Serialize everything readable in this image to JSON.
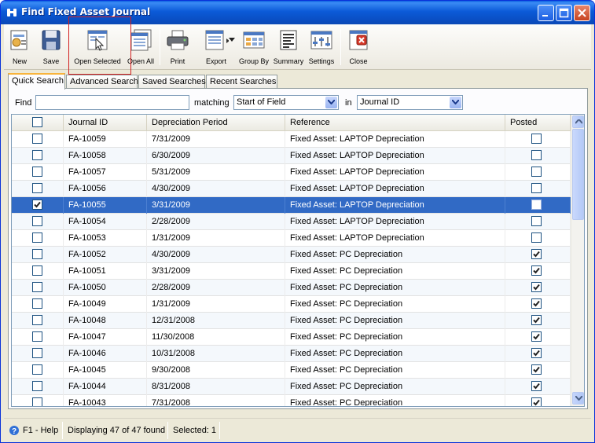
{
  "window": {
    "title": "Find Fixed Asset Journal"
  },
  "toolbar": {
    "buttons": [
      {
        "label": "New",
        "icon": "new-document-icon"
      },
      {
        "label": "Save",
        "icon": "floppy-disk-icon"
      },
      {
        "label": "Open Selected",
        "icon": "open-selected-icon"
      },
      {
        "label": "Open All",
        "icon": "open-all-icon"
      },
      {
        "label": "Print",
        "icon": "printer-icon"
      },
      {
        "label": "Export",
        "icon": "export-icon"
      },
      {
        "label": "Group By",
        "icon": "group-by-icon"
      },
      {
        "label": "Summary",
        "icon": "summary-icon"
      },
      {
        "label": "Settings",
        "icon": "settings-icon"
      },
      {
        "label": "Close",
        "icon": "close-document-icon"
      }
    ]
  },
  "tabs": [
    "Quick Search",
    "Advanced Search",
    "Saved Searches",
    "Recent Searches"
  ],
  "search": {
    "find_label": "Find",
    "find_value": "",
    "matching_label": "matching",
    "matching_value": "Start of Field",
    "in_label": "in",
    "in_value": "Journal ID"
  },
  "grid": {
    "columns": [
      "",
      "Journal ID",
      "Depreciation Period",
      "Reference",
      "Posted"
    ],
    "rows": [
      {
        "selected": false,
        "id": "FA-10059",
        "period": "7/31/2009",
        "reference": "Fixed Asset: LAPTOP Depreciation",
        "posted": false
      },
      {
        "selected": false,
        "id": "FA-10058",
        "period": "6/30/2009",
        "reference": "Fixed Asset: LAPTOP Depreciation",
        "posted": false
      },
      {
        "selected": false,
        "id": "FA-10057",
        "period": "5/31/2009",
        "reference": "Fixed Asset: LAPTOP Depreciation",
        "posted": false
      },
      {
        "selected": false,
        "id": "FA-10056",
        "period": "4/30/2009",
        "reference": "Fixed Asset: LAPTOP Depreciation",
        "posted": false
      },
      {
        "selected": true,
        "id": "FA-10055",
        "period": "3/31/2009",
        "reference": "Fixed Asset: LAPTOP Depreciation",
        "posted": false
      },
      {
        "selected": false,
        "id": "FA-10054",
        "period": "2/28/2009",
        "reference": "Fixed Asset: LAPTOP Depreciation",
        "posted": false
      },
      {
        "selected": false,
        "id": "FA-10053",
        "period": "1/31/2009",
        "reference": "Fixed Asset: LAPTOP Depreciation",
        "posted": false
      },
      {
        "selected": false,
        "id": "FA-10052",
        "period": "4/30/2009",
        "reference": "Fixed Asset: PC Depreciation",
        "posted": true
      },
      {
        "selected": false,
        "id": "FA-10051",
        "period": "3/31/2009",
        "reference": "Fixed Asset: PC Depreciation",
        "posted": true
      },
      {
        "selected": false,
        "id": "FA-10050",
        "period": "2/28/2009",
        "reference": "Fixed Asset: PC Depreciation",
        "posted": true
      },
      {
        "selected": false,
        "id": "FA-10049",
        "period": "1/31/2009",
        "reference": "Fixed Asset: PC Depreciation",
        "posted": true
      },
      {
        "selected": false,
        "id": "FA-10048",
        "period": "12/31/2008",
        "reference": "Fixed Asset: PC Depreciation",
        "posted": true
      },
      {
        "selected": false,
        "id": "FA-10047",
        "period": "11/30/2008",
        "reference": "Fixed Asset: PC Depreciation",
        "posted": true
      },
      {
        "selected": false,
        "id": "FA-10046",
        "period": "10/31/2008",
        "reference": "Fixed Asset: PC Depreciation",
        "posted": true
      },
      {
        "selected": false,
        "id": "FA-10045",
        "period": "9/30/2008",
        "reference": "Fixed Asset: PC Depreciation",
        "posted": true
      },
      {
        "selected": false,
        "id": "FA-10044",
        "period": "8/31/2008",
        "reference": "Fixed Asset: PC Depreciation",
        "posted": true
      },
      {
        "selected": false,
        "id": "FA-10043",
        "period": "7/31/2008",
        "reference": "Fixed Asset: PC Depreciation",
        "posted": true
      }
    ]
  },
  "status": {
    "help": "F1 - Help",
    "displaying": "Displaying 47 of 47 found",
    "selected": "Selected: 1"
  },
  "colors": {
    "selection": "#316ac5",
    "titlebar": "#0a5fe0",
    "annotation_box": "#d22020"
  }
}
